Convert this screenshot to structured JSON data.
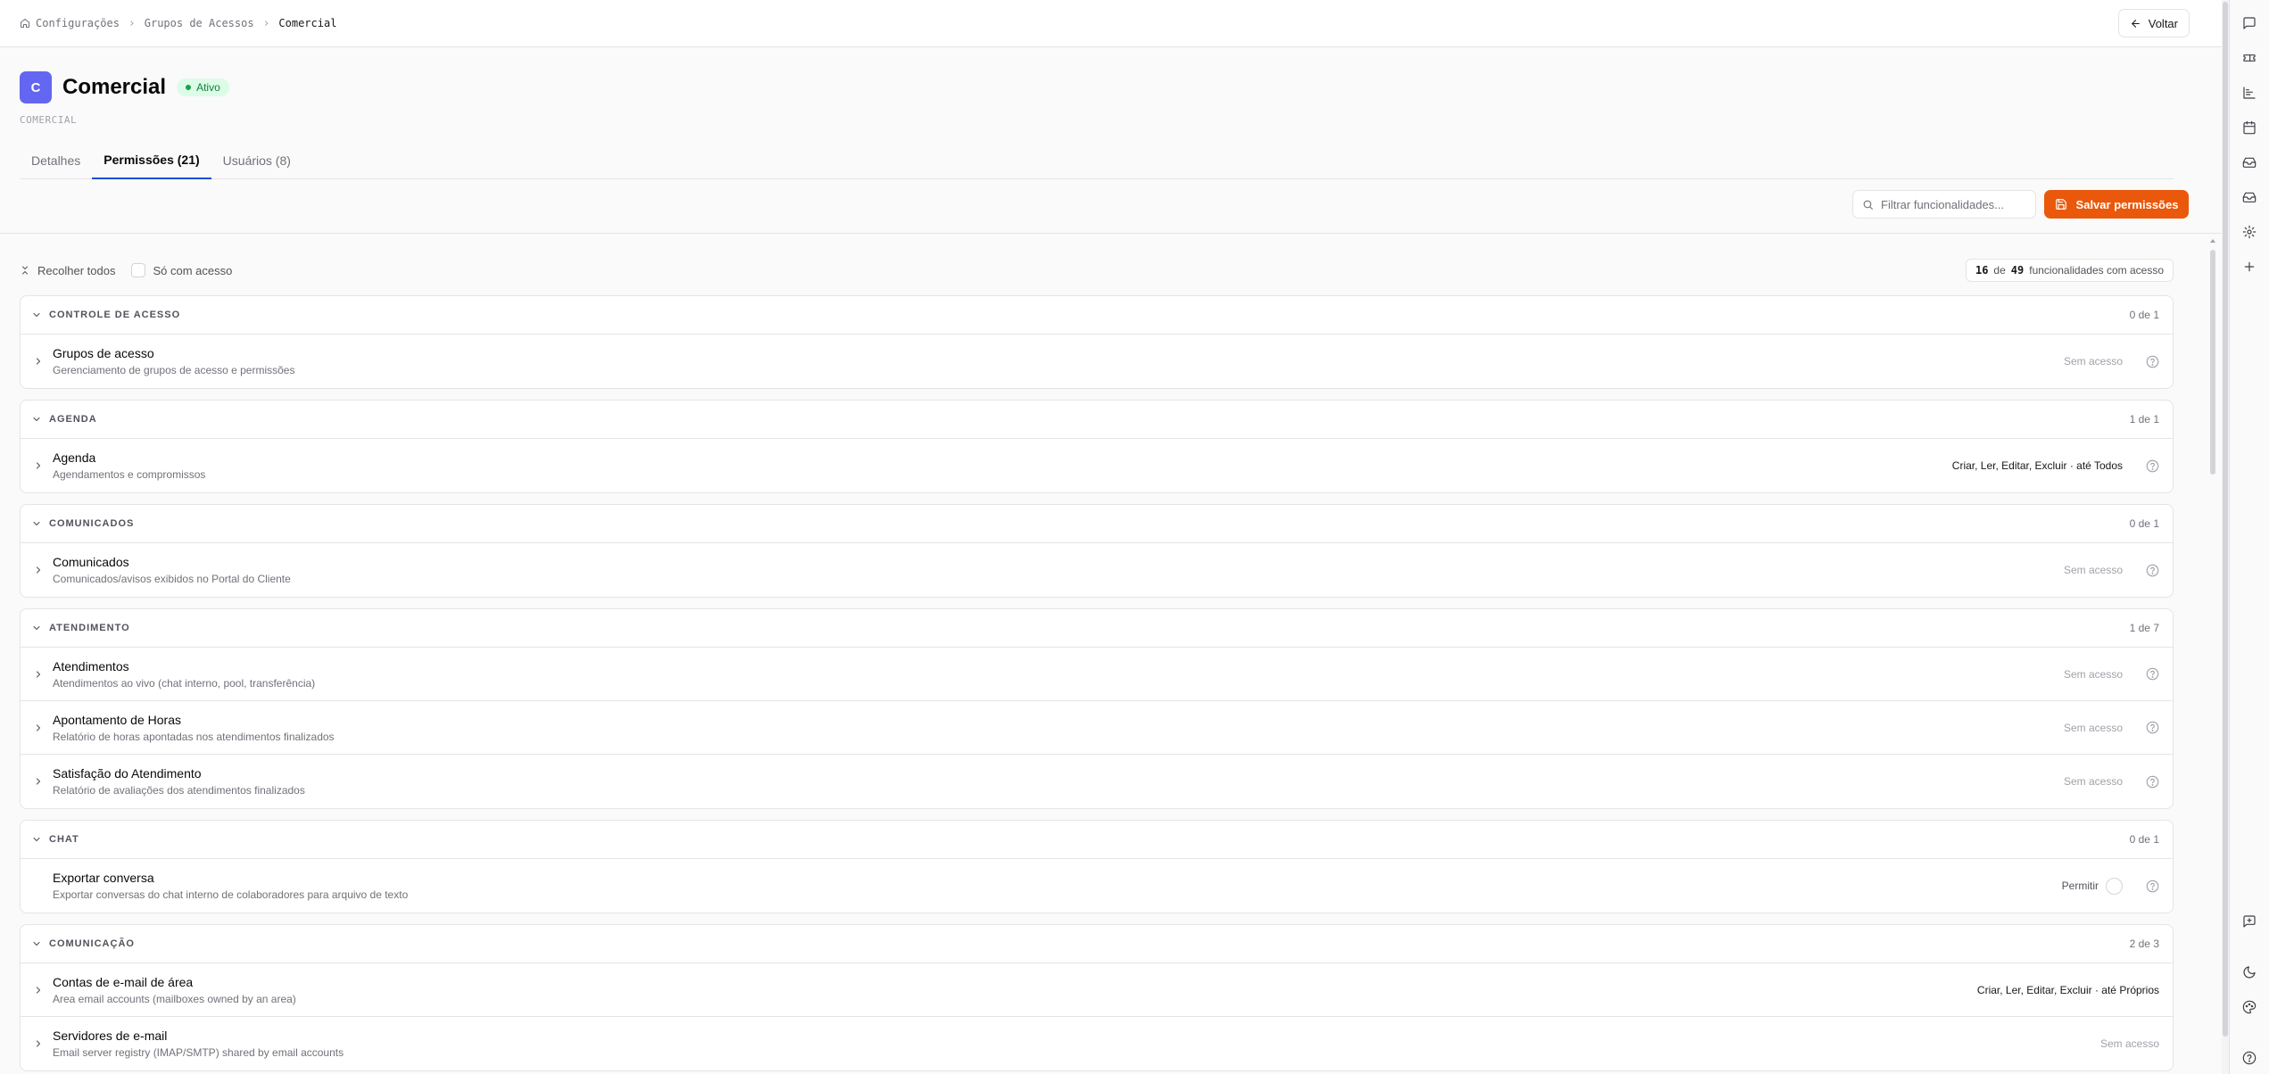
{
  "breadcrumb": {
    "items": [
      "Configurações",
      "Grupos de Acessos",
      "Comercial"
    ]
  },
  "back_button": {
    "label": "Voltar"
  },
  "header": {
    "avatar_letter": "C",
    "title": "Comercial",
    "status": "Ativo",
    "slug": "COMERCIAL"
  },
  "tabs": [
    {
      "label": "Detalhes",
      "active": false
    },
    {
      "label": "Permissões (21)",
      "active": true
    },
    {
      "label": "Usuários (8)",
      "active": false
    }
  ],
  "actions": {
    "filter_placeholder": "Filtrar funcionalidades...",
    "save_label": "Salvar permissões"
  },
  "toolbar": {
    "collapse_all_label": "Recolher todos",
    "only_access_label": "Só com acesso",
    "counter_current": "16",
    "counter_of": "de",
    "counter_total": "49",
    "counter_suffix": "funcionalidades com acesso"
  },
  "groups": [
    {
      "name": "CONTROLE DE ACESSO",
      "count": "0 de 1",
      "items": [
        {
          "title": "Grupos de acesso",
          "desc": "Gerenciamento de grupos de acesso e permissões",
          "status": "Sem acesso"
        }
      ]
    },
    {
      "name": "AGENDA",
      "count": "1 de 1",
      "items": [
        {
          "title": "Agenda",
          "desc": "Agendamentos e compromissos",
          "status": "Criar, Ler, Editar, Excluir · até Todos"
        }
      ]
    },
    {
      "name": "COMUNICADOS",
      "count": "0 de 1",
      "items": [
        {
          "title": "Comunicados",
          "desc": "Comunicados/avisos exibidos no Portal do Cliente",
          "status": "Sem acesso"
        }
      ]
    },
    {
      "name": "ATENDIMENTO",
      "count": "1 de 7",
      "items": [
        {
          "title": "Atendimentos",
          "desc": "Atendimentos ao vivo (chat interno, pool, transferência)",
          "status": "Sem acesso"
        },
        {
          "title": "Apontamento de Horas",
          "desc": "Relatório de horas apontadas nos atendimentos finalizados",
          "status": "Sem acesso"
        },
        {
          "title": "Satisfação do Atendimento",
          "desc": "Relatório de avaliações dos atendimentos finalizados",
          "status": "Sem acesso"
        }
      ]
    },
    {
      "name": "CHAT",
      "count": "0 de 1",
      "items": [
        {
          "title": "Exportar conversa",
          "desc": "Exportar conversas do chat interno de colaboradores para arquivo de texto",
          "status": "Permitir"
        }
      ]
    },
    {
      "name": "COMUNICAÇÃO",
      "count": "2 de 3",
      "items": [
        {
          "title": "Contas de e-mail de área",
          "desc": "Area email accounts (mailboxes owned by an area)",
          "status": "Criar, Ler, Editar, Excluir · até Próprios"
        },
        {
          "title": "Servidores de e-mail",
          "desc": "Email server registry (IMAP/SMTP) shared by email accounts",
          "status": "Sem acesso"
        }
      ]
    }
  ],
  "colors": {
    "accent": "#ea580c",
    "avatar": "#6366f1",
    "active_tab": "#1d4ed8",
    "status_bg": "#dcfce7",
    "status_fg": "#15803d"
  },
  "rail_icons": [
    "chat-icon",
    "ticket-icon",
    "chart-icon",
    "calendar-icon",
    "inbox-icon",
    "inbox-alt-icon",
    "settings-icon",
    "plus-icon",
    "message-square-icon",
    "moon-icon",
    "palette-icon",
    "help-icon"
  ]
}
